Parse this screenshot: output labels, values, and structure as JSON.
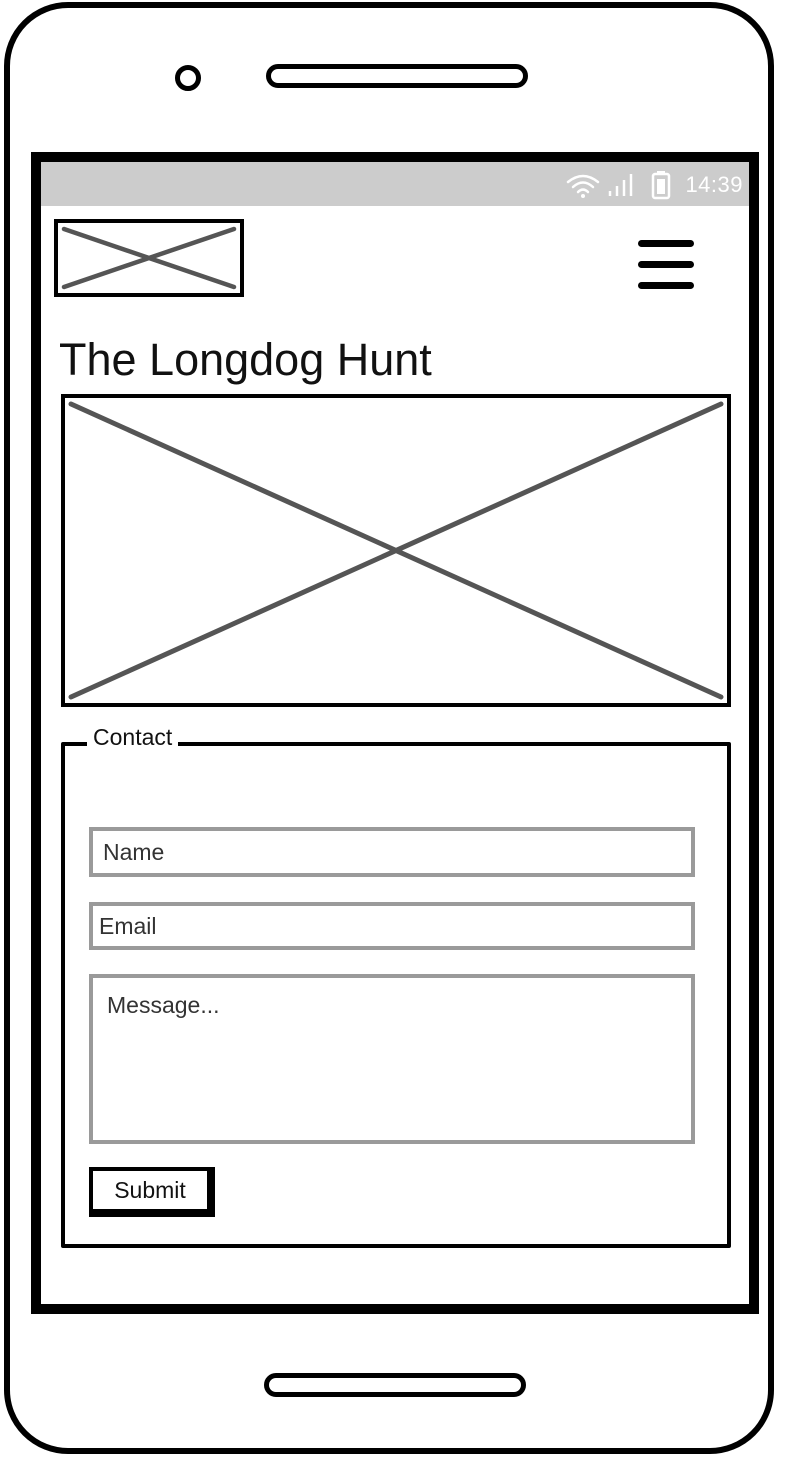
{
  "status_bar": {
    "time": "14:39",
    "icons": [
      "wifi-icon",
      "signal-icon",
      "battery-icon"
    ],
    "background_color": "#cccccc"
  },
  "header": {
    "logo_icon": "image-placeholder-icon",
    "menu_icon": "hamburger-menu-icon"
  },
  "page": {
    "title": "The Longdog Hunt",
    "hero_icon": "image-placeholder-icon"
  },
  "contact": {
    "legend": "Contact",
    "name_placeholder": "Name",
    "email_placeholder": "Email",
    "message_placeholder": "Message...",
    "submit_label": "Submit"
  },
  "colors": {
    "frame": "#000000",
    "placeholder_cross": "#555555",
    "field_border": "#9a9a9a"
  }
}
